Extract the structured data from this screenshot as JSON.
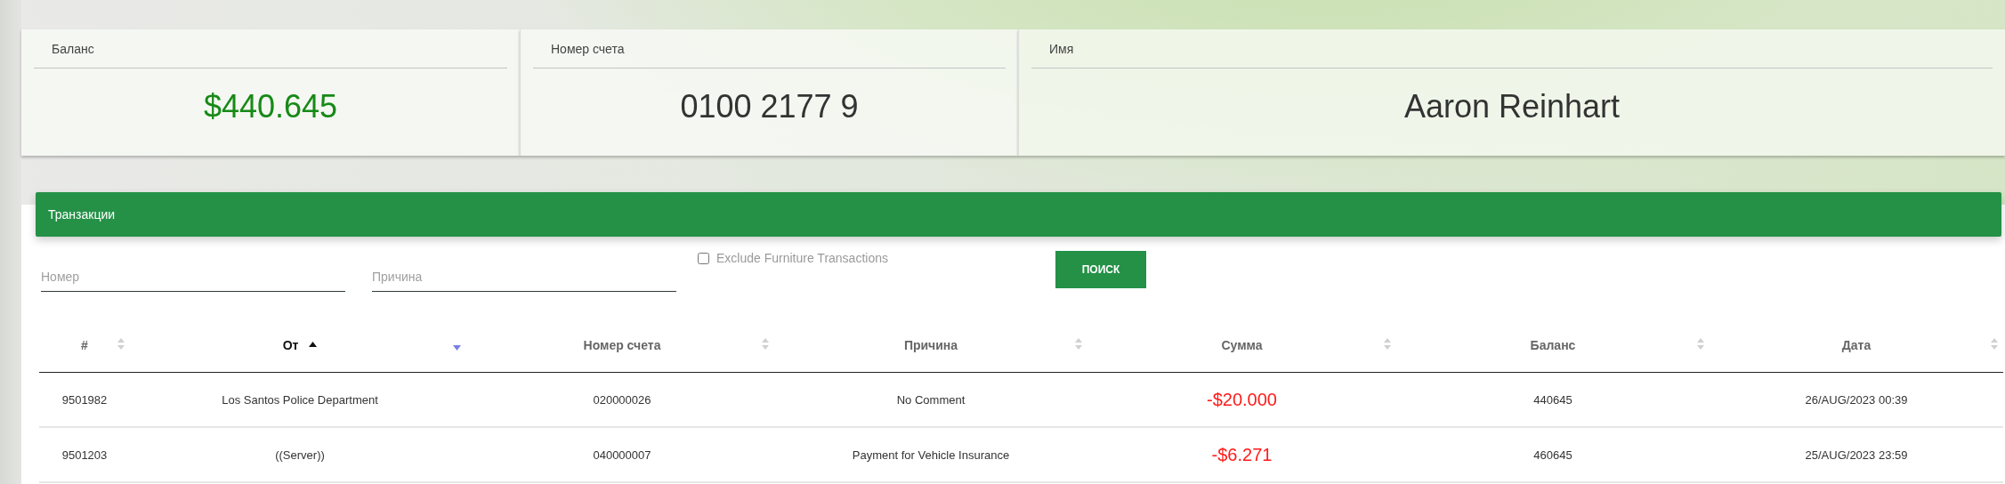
{
  "cards": [
    {
      "label": "Баланс",
      "value": "$440.645",
      "kind": "money"
    },
    {
      "label": "Номер счета",
      "value": "0100 2177 9",
      "kind": "plain"
    },
    {
      "label": "Имя",
      "value": "Aaron Reinhart",
      "kind": "plain"
    }
  ],
  "transactions": {
    "title": "Транзакции",
    "filters": {
      "number": {
        "placeholder": "Номер"
      },
      "reason": {
        "placeholder": "Причина"
      },
      "exclude_furniture": {
        "label": "Exclude Furniture Transactions",
        "checked": false
      },
      "search_button": "ПОИСК"
    },
    "columns": [
      {
        "label": "#",
        "sorted": false
      },
      {
        "label": "От",
        "sorted": true
      },
      {
        "label": "Номер счета",
        "sorted": false
      },
      {
        "label": "Причина",
        "sorted": false
      },
      {
        "label": "Сумма",
        "sorted": false
      },
      {
        "label": "Баланс",
        "sorted": false
      },
      {
        "label": "Дата",
        "sorted": false
      }
    ],
    "rows": [
      {
        "cells": [
          "9501982",
          "Los Santos Police Department",
          "020000026",
          "No Comment",
          "-$20.000",
          "440645",
          "26/AUG/2023 00:39"
        ],
        "kind": "debit"
      },
      {
        "cells": [
          "9501203",
          "((Server))",
          "040000007",
          "Payment for Vehicle Insurance",
          "-$6.271",
          "460645",
          "25/AUG/2023 23:59"
        ],
        "kind": "debit"
      }
    ]
  }
}
